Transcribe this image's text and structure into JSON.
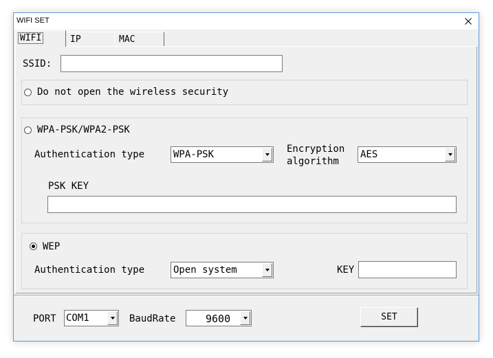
{
  "window": {
    "title": "WIFI SET",
    "close_glyph": "✕"
  },
  "tabs": [
    {
      "label": "WIFI",
      "active": true
    },
    {
      "label": "IP",
      "active": false
    },
    {
      "label": "MAC",
      "active": false
    }
  ],
  "ssid": {
    "label": "SSID:",
    "value": ""
  },
  "security_none": {
    "label": "Do not open the wireless security",
    "selected": false
  },
  "wpa": {
    "label": "WPA-PSK/WPA2-PSK",
    "selected": false,
    "auth_label": "Authentication type",
    "auth_value": "WPA-PSK",
    "enc_label_line1": "Encryption",
    "enc_label_line2": "algorithm",
    "enc_value": "AES",
    "psk_label": "PSK KEY",
    "psk_value": ""
  },
  "wep": {
    "label": "WEP",
    "selected": true,
    "auth_label": "Authentication type",
    "auth_value": "Open system",
    "key_label": "KEY",
    "key_value": ""
  },
  "footer": {
    "port_label": "PORT",
    "port_value": "COM1",
    "baud_label": "BaudRate",
    "baud_value": "9600",
    "set_label": "SET"
  },
  "icons": {
    "close": "close-icon",
    "dropdown": "chevron-down-icon",
    "radio": "radio-icon"
  }
}
